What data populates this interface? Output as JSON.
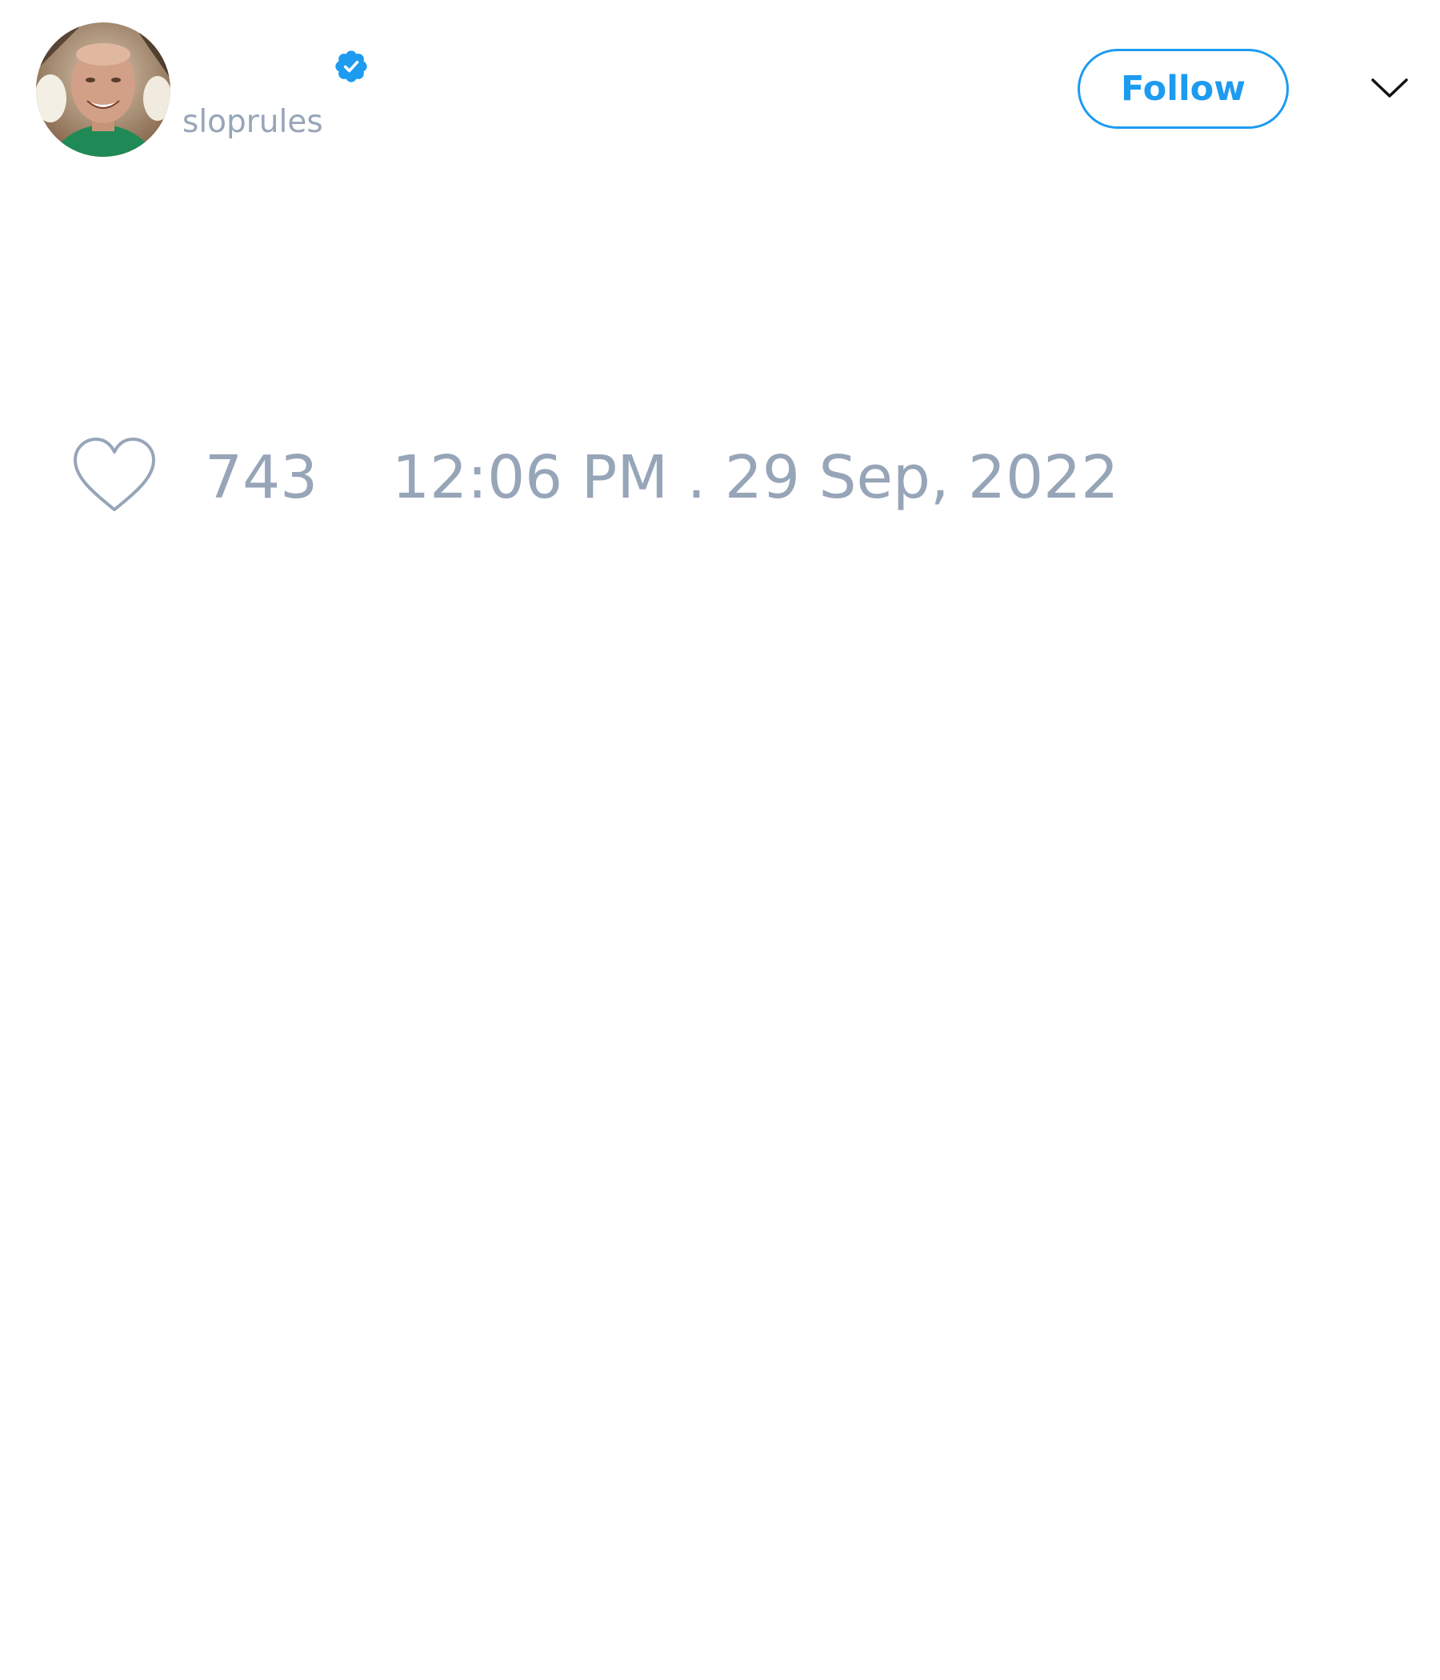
{
  "author": {
    "display_name": "",
    "handle": "sloprules",
    "verified": true,
    "avatar_icon": "user-photo-avatar"
  },
  "actions": {
    "follow_label": "Follow",
    "menu_icon": "chevron-down-icon"
  },
  "engagement": {
    "like_icon": "heart-outline-icon",
    "likes": "743",
    "timestamp": "12:06 PM . 29 Sep, 2022"
  },
  "colors": {
    "accent": "#1d9bf0",
    "muted_text": "#97a5b8",
    "background": "#ffffff"
  }
}
